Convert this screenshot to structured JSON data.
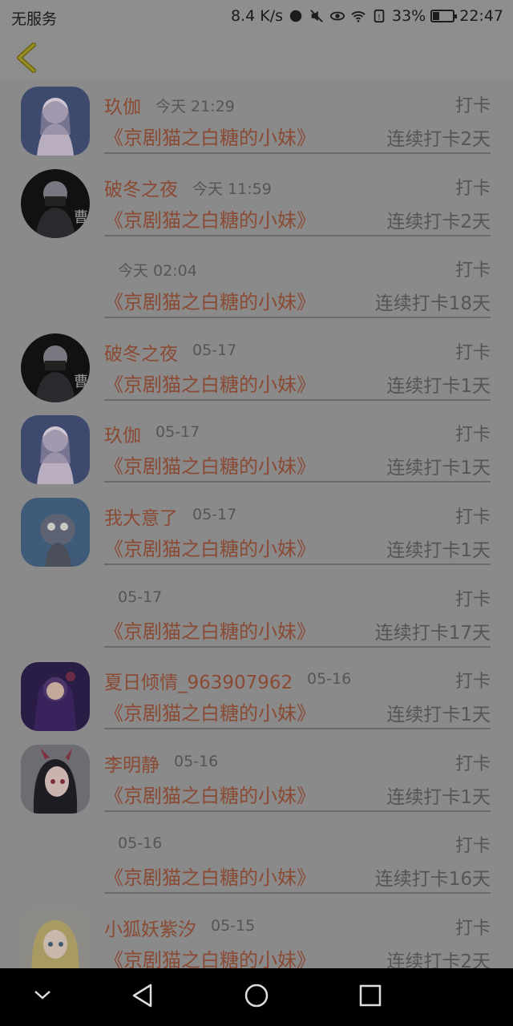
{
  "status": {
    "carrier": "无服务",
    "speed": "8.4 K/s",
    "battery_text": "33%",
    "battery_level": 0.33,
    "time": "22:47"
  },
  "header": {
    "back_icon": "chevron-left-icon"
  },
  "feed": [
    {
      "name": "玖伽",
      "time": "今天 21:29",
      "tag": "打卡",
      "book": "《京剧猫之白糖的小妹》",
      "streak": "连续打卡2天",
      "avatar": "girl-white"
    },
    {
      "name": "破冬之夜",
      "time": "今天 11:59",
      "tag": "打卡",
      "book": "《京剧猫之白糖的小妹》",
      "streak": "连续打卡2天",
      "avatar": "dark-round"
    },
    {
      "name": "",
      "time": "今天 02:04",
      "tag": "打卡",
      "book": "《京剧猫之白糖的小妹》",
      "streak": "连续打卡18天",
      "avatar": ""
    },
    {
      "name": "破冬之夜",
      "time": "05-17",
      "tag": "打卡",
      "book": "《京剧猫之白糖的小妹》",
      "streak": "连续打卡1天",
      "avatar": "dark-round"
    },
    {
      "name": "玖伽",
      "time": "05-17",
      "tag": "打卡",
      "book": "《京剧猫之白糖的小妹》",
      "streak": "连续打卡1天",
      "avatar": "girl-white"
    },
    {
      "name": "我大意了",
      "time": "05-17",
      "tag": "打卡",
      "book": "《京剧猫之白糖的小妹》",
      "streak": "连续打卡1天",
      "avatar": "cartoon-cat"
    },
    {
      "name": "",
      "time": "05-17",
      "tag": "打卡",
      "book": "《京剧猫之白糖的小妹》",
      "streak": "连续打卡17天",
      "avatar": ""
    },
    {
      "name": "夏日倾情_963907962",
      "time": "05-16",
      "tag": "打卡",
      "book": "《京剧猫之白糖的小妹》",
      "streak": "连续打卡1天",
      "avatar": "girl-purple"
    },
    {
      "name": "李明静",
      "time": "05-16",
      "tag": "打卡",
      "book": "《京剧猫之白糖的小妹》",
      "streak": "连续打卡1天",
      "avatar": "girl-red"
    },
    {
      "name": "",
      "time": "05-16",
      "tag": "打卡",
      "book": "《京剧猫之白糖的小妹》",
      "streak": "连续打卡16天",
      "avatar": ""
    },
    {
      "name": "小狐妖紫汐",
      "time": "05-15",
      "tag": "打卡",
      "book": "《京剧猫之白糖的小妹》",
      "streak": "连续打卡2天",
      "avatar": "girl-blonde"
    }
  ],
  "nav": {
    "icons": [
      "chevron-down-icon",
      "back-triangle-icon",
      "home-circle-icon",
      "recent-square-icon"
    ]
  }
}
